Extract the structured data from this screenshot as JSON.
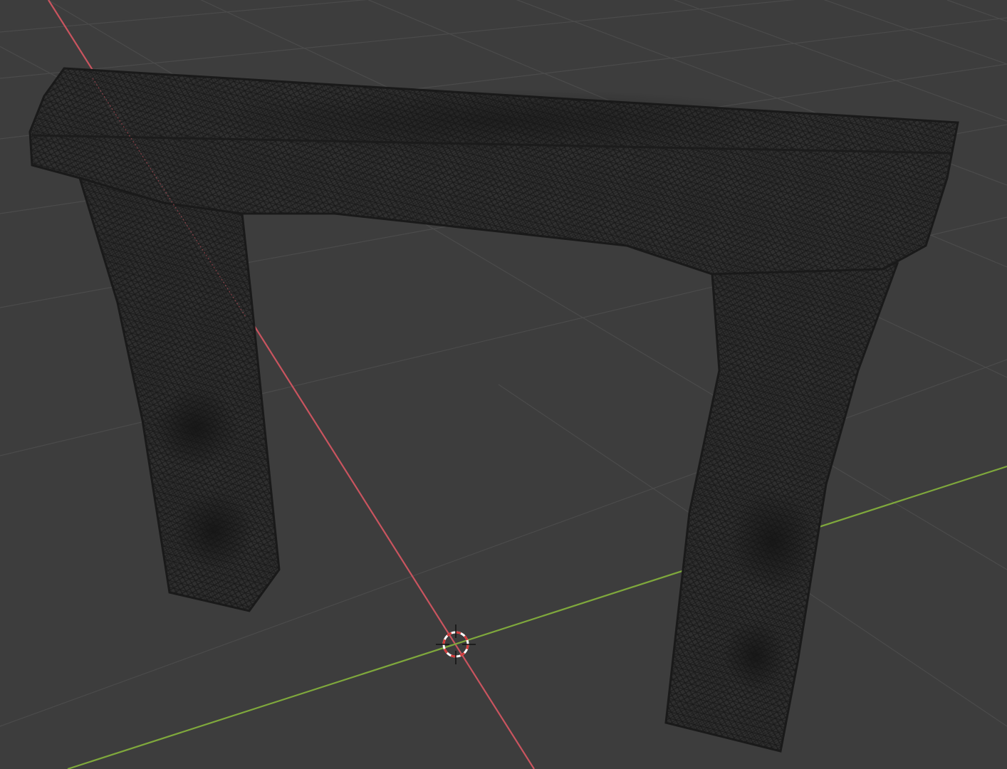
{
  "app": {
    "view": "3D viewport",
    "shading_mode": "wireframe"
  },
  "colors": {
    "background": "#3d3d3d",
    "grid_line": "#4a4a4a",
    "axis_x": "#c9545f",
    "axis_y": "#7fa83c",
    "mesh_fill": "#2e2e2e",
    "mesh_wire": "#141414",
    "cursor_red": "#d23a3a",
    "cursor_white": "#ffffff"
  },
  "scene": {
    "object": "stone-arch-mesh",
    "parts": [
      "top-lintel",
      "left-pillar",
      "right-pillar"
    ],
    "cursor_icon": "3d-cursor-icon"
  }
}
